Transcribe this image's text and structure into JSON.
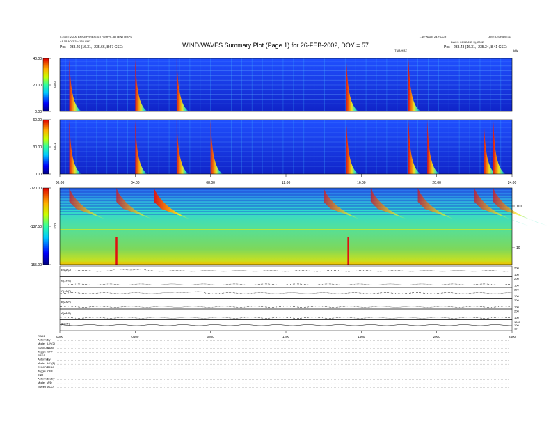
{
  "header": {
    "title": "WIND/WAVES Summary Plot (Page 1) for 26-FEB-2002, DOY = 57",
    "left_line1": "0.230 = 2(200 BP/CBP/(RBS/3C) (%/mV) - ATTENT@BPS",
    "left_line2": "ASJ/RAD 2.3 = 135 GHZ",
    "left_pos_label": "Pos",
    "left_pos_value": "233.26 (16.31, -235.66, 8.67 GSE)",
    "center_tag": "TNR/HRZ",
    "right_line1": "LRS/TDS/R5 vE11",
    "right_line2": "1.10 WAVE 24.F.CCR",
    "right_line3": "DAILY: 26/02/2(2, 3), 2002",
    "right_pos_label": "Pos",
    "right_pos_value": "233.43 (16.31, -235.34, 8.41 GSE)",
    "unit_tag": "kHz"
  },
  "colors": {
    "spectrogram_low": "#1030d8",
    "spectrogram_mid": "#27e0c8",
    "spectrogram_high": "#e01010",
    "tnr_background": "#7dd85a",
    "line_plot": "#000000"
  },
  "chart_data": [
    {
      "type": "heatmap",
      "panel": "RAD2",
      "ylabel": "RAD2",
      "colorbar_ticks": [
        "40.00",
        "20.00",
        "0.00"
      ],
      "zlim": [
        0,
        40
      ],
      "bursts_hours": [
        0.5,
        4.0,
        6.2,
        15.2,
        18.5
      ]
    },
    {
      "type": "heatmap",
      "panel": "RAD1",
      "ylabel": "RAD1",
      "colorbar_ticks": [
        "60.00",
        "30.00",
        "0.00"
      ],
      "zlim": [
        0,
        60
      ],
      "bursts_hours": [
        0.5,
        4.0,
        6.2,
        8.0,
        15.2,
        18.5,
        19.5,
        22.5,
        23.0
      ],
      "x_ticks": [
        "00:00",
        "04:00",
        "08:00",
        "12:00",
        "16:00",
        "20:00",
        "24:00"
      ],
      "x_range_hours": [
        0,
        24
      ]
    },
    {
      "type": "heatmap",
      "panel": "TNR",
      "ylabel": "TNR",
      "colorbar_ticks": [
        "-120.00",
        "-137.50",
        "-155.00"
      ],
      "zlim": [
        -155,
        -120
      ],
      "right_axis_ticks": [
        "100",
        "10"
      ],
      "bursts_hours": [
        0.5,
        3.0,
        5.0,
        14.0,
        16.5,
        19.0,
        22.0,
        23.0
      ],
      "spikes_hours": [
        3.0,
        15.3
      ]
    },
    {
      "type": "line",
      "panel": "stack",
      "series": [
        {
          "name": "E(ADC)",
          "right_ticks": [
            "200",
            "100"
          ],
          "level": 0.55
        },
        {
          "name": "D(ADC)",
          "right_ticks": [
            "200",
            "100"
          ],
          "level": 0.2
        },
        {
          "name": "C(ADC)",
          "right_ticks": [
            "200",
            "100"
          ],
          "level": 0.45
        },
        {
          "name": "B(ADC)",
          "right_ticks": [
            "200",
            "100"
          ],
          "level": 0.12
        },
        {
          "name": "A(ADC)",
          "right_ticks": [
            "200",
            "100"
          ],
          "level": 0.08
        },
        {
          "name": "|B|(nT)",
          "right_ticks": [
            "1000",
            "100",
            "10"
          ],
          "level": 0.5
        }
      ],
      "x_ticks": [
        "0000",
        "0400",
        "0800",
        "1200",
        "1600",
        "2000",
        "2400"
      ]
    }
  ],
  "footer": {
    "sections": [
      {
        "title": "RAD2",
        "rows": [
          {
            "label": "Antenna",
            "value": "Ey"
          },
          {
            "label": "Mode",
            "value": "LIN(2)"
          },
          {
            "label": "SUM/DAF",
            "value": "SUM"
          },
          {
            "label": "Toggle",
            "value": "OFF"
          }
        ]
      },
      {
        "title": "RAD1",
        "rows": [
          {
            "label": "Antenna",
            "value": "Ey"
          },
          {
            "label": "Mode",
            "value": "LIN(2)"
          },
          {
            "label": "SUM/DAF",
            "value": "SUM"
          },
          {
            "label": "Toggle",
            "value": "OFF"
          }
        ]
      },
      {
        "title": "TNR",
        "rows": [
          {
            "label": "Antenna",
            "value": "Ex/Ey"
          },
          {
            "label": "Mode",
            "value": "A/D"
          },
          {
            "label": "Sweep",
            "value": "ACQ"
          }
        ]
      }
    ]
  }
}
